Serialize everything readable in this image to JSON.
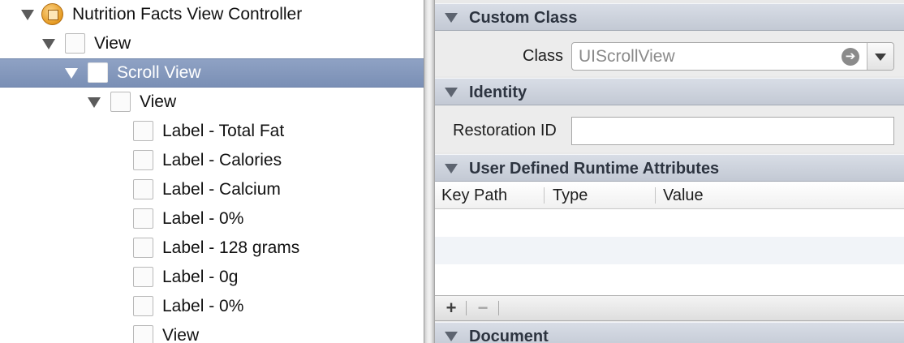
{
  "outline": {
    "items": [
      {
        "label": "Nutrition Facts View Controller",
        "kind": "view-controller",
        "expanded": true,
        "selected": false
      },
      {
        "label": "View",
        "kind": "view",
        "expanded": true,
        "selected": false
      },
      {
        "label": "Scroll View",
        "kind": "view",
        "expanded": true,
        "selected": true
      },
      {
        "label": "View",
        "kind": "view",
        "expanded": true,
        "selected": false
      },
      {
        "label": "Label - Total Fat",
        "kind": "label",
        "selected": false
      },
      {
        "label": "Label - Calories",
        "kind": "label",
        "selected": false
      },
      {
        "label": "Label - Calcium",
        "kind": "label",
        "selected": false
      },
      {
        "label": "Label - 0%",
        "kind": "label",
        "selected": false
      },
      {
        "label": "Label - 128 grams",
        "kind": "label",
        "selected": false
      },
      {
        "label": "Label - 0g",
        "kind": "label",
        "selected": false
      },
      {
        "label": "Label - 0%",
        "kind": "label",
        "selected": false
      },
      {
        "label": "View",
        "kind": "view",
        "selected": false
      }
    ]
  },
  "inspector": {
    "custom_class": {
      "title": "Custom Class",
      "class_label": "Class",
      "class_value": "UIScrollView"
    },
    "identity": {
      "title": "Identity",
      "restoration_id_label": "Restoration ID",
      "restoration_id_value": ""
    },
    "runtime_attributes": {
      "title": "User Defined Runtime Attributes",
      "columns": [
        "Key Path",
        "Type",
        "Value"
      ],
      "rows": [],
      "add_button": "+",
      "remove_button": "−"
    },
    "document": {
      "title": "Document"
    }
  },
  "colors": {
    "selection": "#7f93b8",
    "section_header": "#c8ced8",
    "inspector_bg": "#ececec"
  }
}
